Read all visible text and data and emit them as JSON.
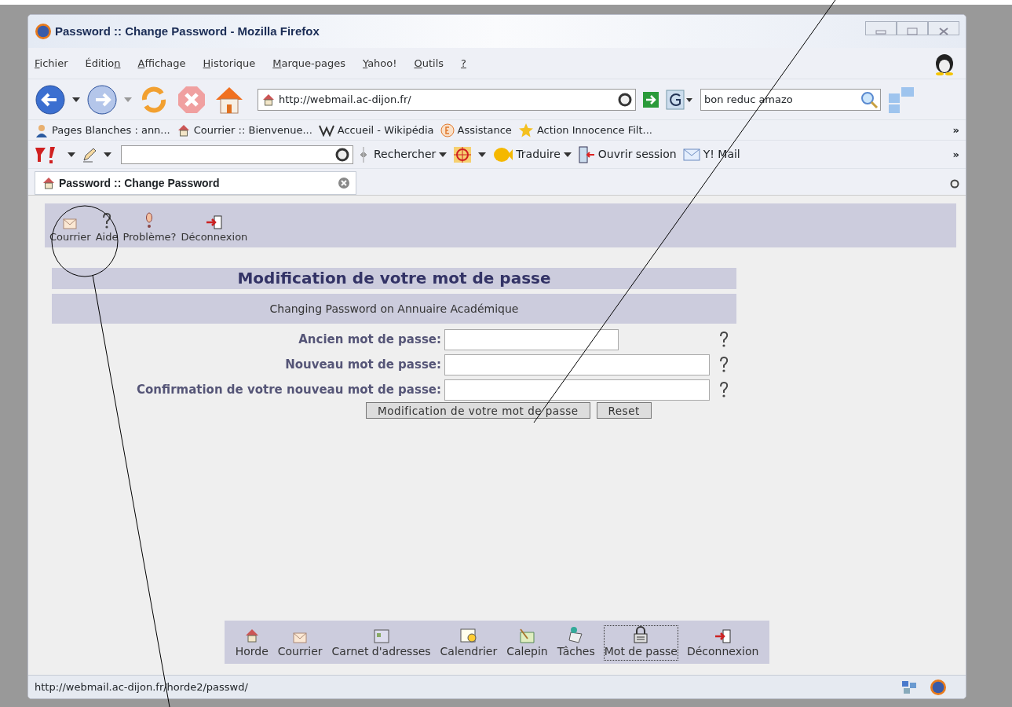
{
  "window": {
    "title": "Password :: Change Password - Mozilla Firefox"
  },
  "menu": [
    {
      "key": "F",
      "after": "ichier"
    },
    {
      "before": "Éditio",
      "key": "n"
    },
    {
      "key": "A",
      "after": "ffichage"
    },
    {
      "key": "H",
      "after": "istorique"
    },
    {
      "key": "M",
      "after": "arque-pages"
    },
    {
      "key": "Y",
      "after": "ahoo!"
    },
    {
      "key": "O",
      "after": "utils"
    },
    {
      "key": "?"
    }
  ],
  "navigation": {
    "address": "http://webmail.ac-dijon.fr/",
    "search": "bon reduc amazo"
  },
  "bookmarks": {
    "items": [
      "Pages Blanches : ann...",
      "Courrier :: Bienvenue...",
      "Accueil - Wikipédia",
      "Assistance",
      "Action Innocence Filt..."
    ],
    "overflow": "»"
  },
  "yahoo_bar": {
    "items": [
      "Rechercher",
      "Traduire",
      "Ouvrir session",
      "Y! Mail"
    ],
    "overflow": "»"
  },
  "tabs": [
    {
      "title": "Password :: Change Password",
      "selected": true
    }
  ],
  "page": {
    "top_nav": [
      "Courrier",
      "Aide",
      "Problème?",
      "Déconnexion"
    ],
    "heading": "Modification de votre mot de passe",
    "subheading": "Changing Password on Annuaire Académique",
    "fields": [
      {
        "label": "Ancien mot de passe:",
        "kind": "short"
      },
      {
        "label": "Nouveau mot de passe:",
        "kind": "long"
      },
      {
        "label": "Confirmation de votre nouveau mot de passe:",
        "kind": "long"
      }
    ],
    "buttons": [
      "Modification de votre mot de passe",
      "Reset"
    ],
    "bottom_nav": [
      {
        "label": "Horde",
        "selected": false
      },
      {
        "label": "Courrier",
        "selected": false
      },
      {
        "label": "Carnet d'adresses",
        "selected": false
      },
      {
        "label": "Calendrier",
        "selected": false
      },
      {
        "label": "Calepin",
        "selected": false
      },
      {
        "label": "Tâches",
        "selected": false
      },
      {
        "label": "Mot de passe",
        "selected": true
      },
      {
        "label": "Déconnexion",
        "selected": false
      }
    ]
  },
  "status_bar": {
    "text": "http://webmail.ac-dijon.fr/horde2/passwd/"
  }
}
